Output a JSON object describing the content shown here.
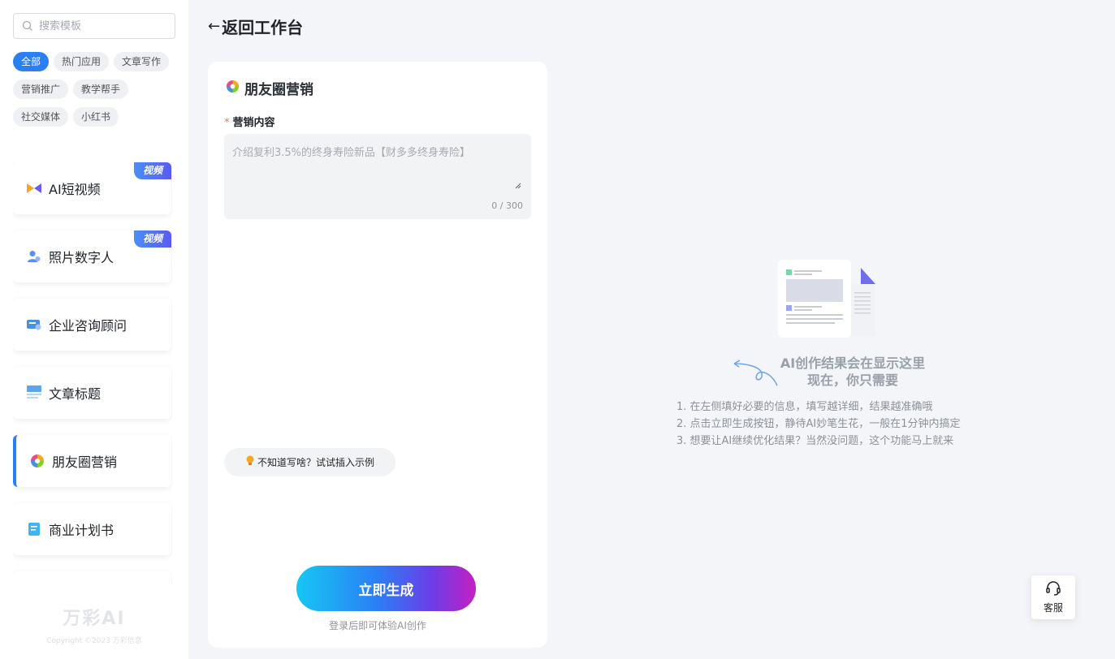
{
  "sidebar": {
    "search_placeholder": "搜索模板",
    "tags": [
      {
        "label": "全部",
        "active": true
      },
      {
        "label": "热门应用"
      },
      {
        "label": "文章写作"
      },
      {
        "label": "营销推广"
      },
      {
        "label": "教学帮手"
      },
      {
        "label": "社交媒体"
      },
      {
        "label": "小红书"
      }
    ],
    "apps": [
      {
        "label": "AI短视频",
        "badge": "视频",
        "icon": "video-bow-icon"
      },
      {
        "label": "照片数字人",
        "badge": "视频",
        "icon": "person-icon"
      },
      {
        "label": "企业咨询顾问",
        "icon": "consult-icon"
      },
      {
        "label": "文章标题",
        "icon": "title-icon"
      },
      {
        "label": "朋友圈营销",
        "icon": "aperture-icon",
        "active": true
      },
      {
        "label": "商业计划书",
        "icon": "doc-icon"
      }
    ],
    "logo": "万彩AI",
    "copyright": "Copyright ©2023 万彩信息"
  },
  "header": {
    "back_label": "返回工作台"
  },
  "form": {
    "title": "朋友圈营销",
    "field_label": "营销内容",
    "required_mark": "*",
    "placeholder": "介绍复利3.5%的终身寿险新品【财多多终身寿险】",
    "counter": "0 / 300",
    "example_label": "不知道写啥？试试插入示例",
    "generate_label": "立即生成",
    "login_tip": "登录后即可体验AI创作"
  },
  "result": {
    "empty_title_line1": "AI创作结果会在显示这里",
    "empty_title_line2": "现在，你只需要",
    "tips": [
      "1. 在左侧填好必要的信息，填写越详细，结果越准确哦",
      "2. 点击立即生成按钮，静待AI妙笔生花，一般在1分钟内搞定",
      "3. 想要让AI继续优化结果？当然没问题，这个功能马上就来"
    ]
  },
  "service": {
    "label": "客服"
  },
  "colors": {
    "accent": "#2b7ff5",
    "badge": "#5a5cf0",
    "required": "#f56c6c"
  }
}
